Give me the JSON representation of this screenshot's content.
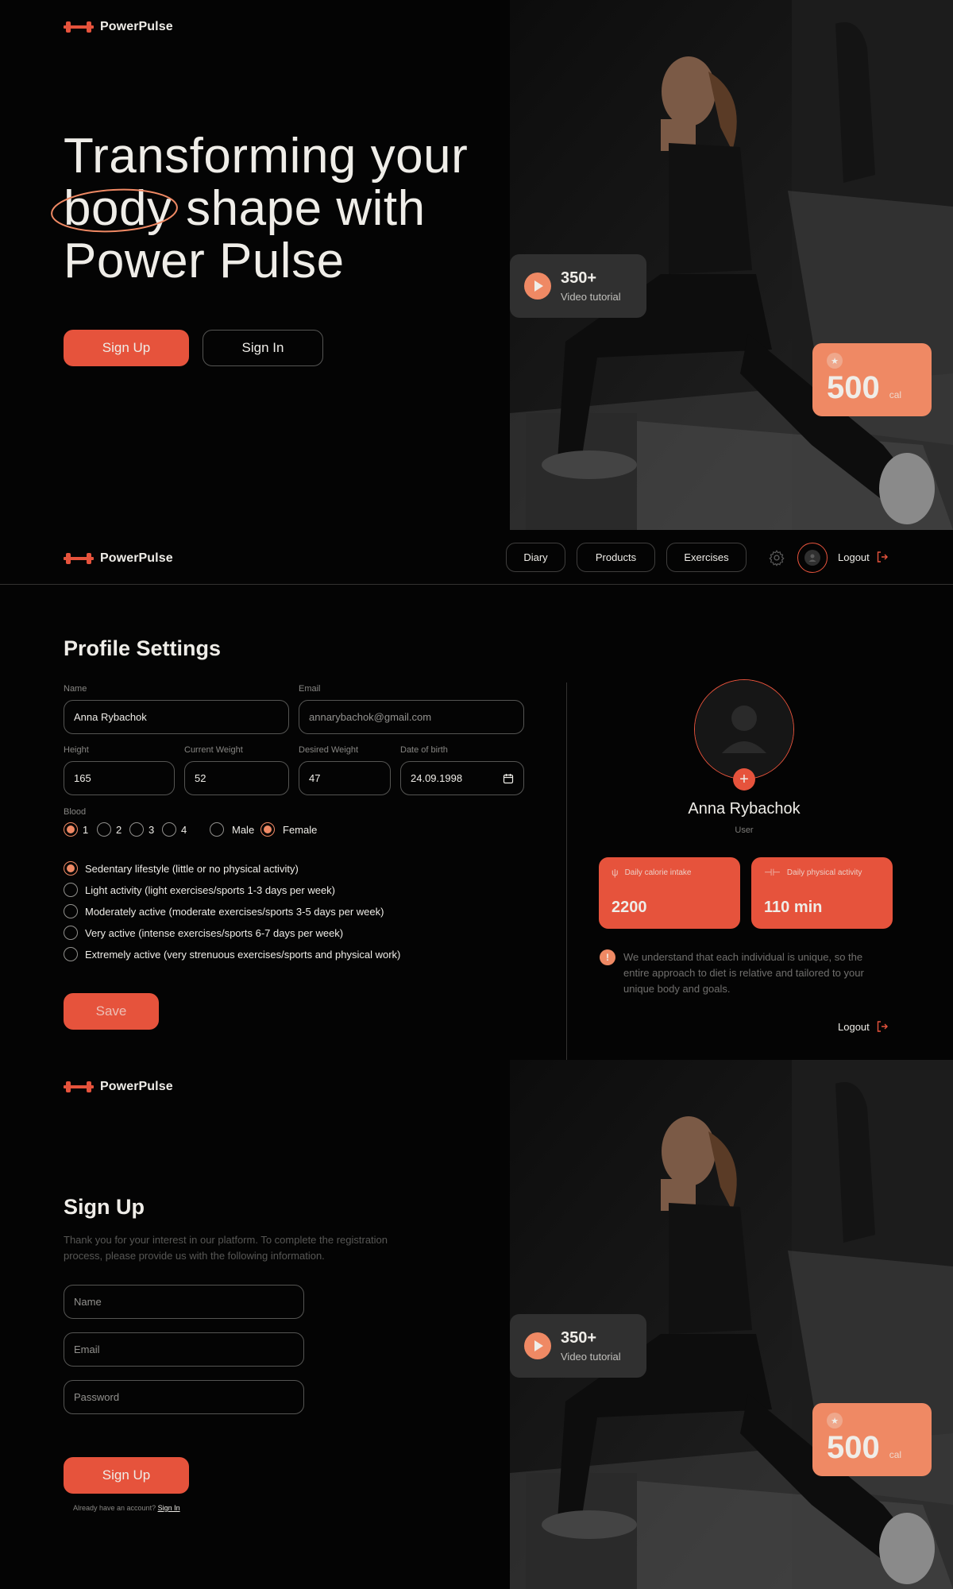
{
  "brand": {
    "name": "PowerPulse"
  },
  "hero": {
    "title_line1": "Transforming your",
    "title_word_circled": "body",
    "title_line2_rest": " shape with",
    "title_line3": "Power Pulse",
    "signup_label": "Sign Up",
    "signin_label": "Sign In"
  },
  "widgets": {
    "tutorial_count": "350+",
    "tutorial_label": "Video tutorial",
    "calories_value": "500",
    "calories_unit": "cal"
  },
  "nav": {
    "items": [
      {
        "label": "Diary"
      },
      {
        "label": "Products"
      },
      {
        "label": "Exercises"
      }
    ],
    "logout_label": "Logout"
  },
  "profile": {
    "title": "Profile Settings",
    "labels": {
      "name": "Name",
      "email": "Email",
      "height": "Height",
      "current_weight": "Current Weight",
      "desired_weight": "Desired Weight",
      "birth": "Date of birth",
      "blood": "Blood"
    },
    "values": {
      "name": "Anna Rybachok",
      "email": "annarybachok@gmail.com",
      "height": "165",
      "current_weight": "52",
      "desired_weight": "47",
      "birth": "24.09.1998"
    },
    "blood_options": [
      "1",
      "2",
      "3",
      "4"
    ],
    "blood_selected": "1",
    "sex_options": [
      "Male",
      "Female"
    ],
    "sex_selected": "Female",
    "activity_options": [
      "Sedentary lifestyle (little or no physical activity)",
      "Light activity (light exercises/sports 1-3 days per week)",
      "Moderately active (moderate exercises/sports 3-5 days per week)",
      "Very active (intense exercises/sports 6-7 days per week)",
      "Extremely active (very strenuous exercises/sports and physical work)"
    ],
    "activity_selected": 0,
    "save_label": "Save",
    "card": {
      "name": "Anna Rybachok",
      "role": "User",
      "calorie_label": "Daily calorie intake",
      "calorie_value": "2200",
      "activity_label": "Daily physical activity",
      "activity_value": "110 min",
      "info": "We understand that each individual is unique, so the entire approach to diet is relative and tailored to your unique body and goals.",
      "logout_label": "Logout"
    }
  },
  "signup": {
    "title": "Sign Up",
    "description": "Thank you for your interest in our platform. To complete the registration process, please provide us with the following information.",
    "name_placeholder": "Name",
    "email_placeholder": "Email",
    "password_placeholder": "Password",
    "submit_label": "Sign Up",
    "already_text": "Already have an account? ",
    "signin_link": "Sign In"
  },
  "colors": {
    "accent": "#e6533c",
    "accent_light": "#ef8964",
    "background": "#040404",
    "text": "#efede8"
  }
}
